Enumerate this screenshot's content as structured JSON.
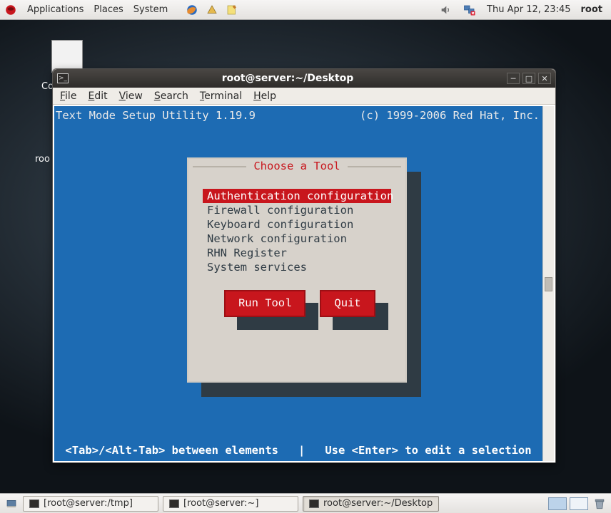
{
  "panel": {
    "menu": {
      "applications": "Applications",
      "places": "Places",
      "system": "System"
    },
    "clock": "Thu Apr 12, 23:45",
    "user": "root"
  },
  "desktop": {
    "icon_label1": "Co",
    "icon_label2": "roo"
  },
  "window": {
    "title": "root@server:~/Desktop",
    "menubar": {
      "file": "File",
      "edit": "Edit",
      "view": "View",
      "search": "Search",
      "terminal": "Terminal",
      "help": "Help"
    }
  },
  "terminal": {
    "header_left": "Text Mode Setup Utility 1.19.9",
    "header_right": "(c) 1999-2006 Red Hat, Inc.",
    "dialog_title": "Choose a Tool",
    "tools": [
      "Authentication configuration",
      "Firewall configuration",
      "Keyboard configuration",
      "Network configuration",
      "RHN Register",
      "System services"
    ],
    "selected_tool_index": 0,
    "buttons": {
      "run": "Run Tool",
      "quit": "Quit"
    },
    "hint": "<Tab>/<Alt-Tab> between elements   |   Use <Enter> to edit a selection"
  },
  "taskbar": {
    "tasks": [
      {
        "label": "[root@server:/tmp]",
        "active": false
      },
      {
        "label": "[root@server:~]",
        "active": false
      },
      {
        "label": "root@server:~/Desktop",
        "active": true
      }
    ]
  }
}
